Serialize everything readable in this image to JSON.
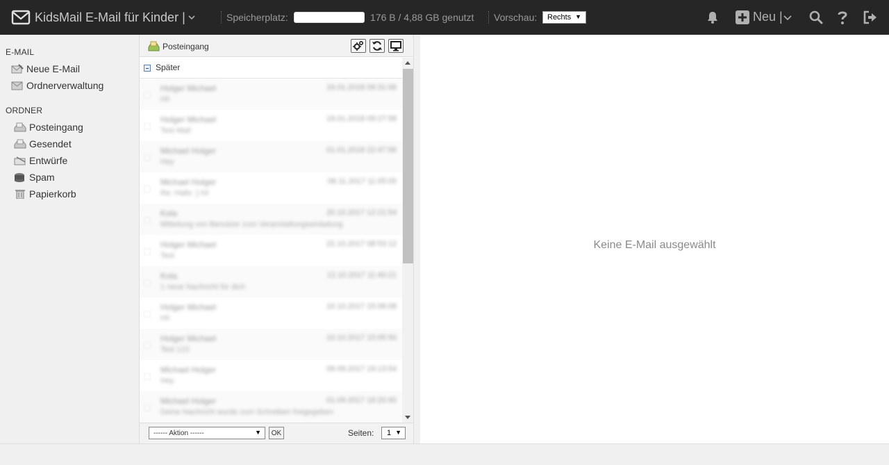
{
  "header": {
    "app_title": "KidsMail E-Mail für Kinder |",
    "storage_label": "Speicherplatz:",
    "storage_used_fraction": 0.0,
    "storage_text": "176 B / 4,88 GB genutzt",
    "preview_label": "Vorschau:",
    "preview_value": "Rechts",
    "new_label": "Neu |",
    "icons": [
      "mail-logo-icon",
      "chevron-down-icon",
      "bell-icon",
      "plus-square-icon",
      "search-icon",
      "help-icon",
      "logout-icon"
    ]
  },
  "sidebar": {
    "email_section": "E-MAIL",
    "email_items": [
      {
        "label": "Neue E-Mail",
        "icon": "compose-icon"
      },
      {
        "label": "Ordnerverwaltung",
        "icon": "folder-manage-icon"
      }
    ],
    "folder_section": "ORDNER",
    "folder_items": [
      {
        "label": "Posteingang",
        "icon": "inbox-icon"
      },
      {
        "label": "Gesendet",
        "icon": "sent-icon"
      },
      {
        "label": "Entwürfe",
        "icon": "drafts-icon"
      },
      {
        "label": "Spam",
        "icon": "spam-icon"
      },
      {
        "label": "Papierkorb",
        "icon": "trash-icon"
      }
    ]
  },
  "maillist": {
    "folder_title": "Posteingang",
    "toolbar_icons": [
      "settings-icon",
      "refresh-icon",
      "display-icon"
    ],
    "group_label": "Später",
    "rows": [
      {
        "sender": "Holger Michael",
        "date": "19.01.2018 09:31:06",
        "subject": "Hi!"
      },
      {
        "sender": "Holger Michael",
        "date": "19.01.2018 09:27:58",
        "subject": "Test Mail"
      },
      {
        "sender": "Michael Holger",
        "date": "01.01.2018 22:47:56",
        "subject": "Hey"
      },
      {
        "sender": "Michael Holger",
        "date": "08.11.2017 11:05:05",
        "subject": "Re: Hallo :) hi!"
      },
      {
        "sender": "Kola",
        "date": "20.10.2017 12:21:54",
        "subject": "Mitteilung von Benutzer zum Veranstaltungseinladung"
      },
      {
        "sender": "Holger Michael",
        "date": "22.10.2017 08:53:12",
        "subject": "Test"
      },
      {
        "sender": "Kola",
        "date": "12.10.2017 11:40:21",
        "subject": "1 neue Nachricht für dich"
      },
      {
        "sender": "Holger Michael",
        "date": "10.10.2017 15:06:08",
        "subject": "Hi!"
      },
      {
        "sender": "Holger Michael",
        "date": "10.10.2017 15:05:50",
        "subject": "Test 123"
      },
      {
        "sender": "Michael Holger",
        "date": "09.09.2017 19:13:54",
        "subject": "Hey"
      },
      {
        "sender": "Michael Holger",
        "date": "01.09.2017 16:20:40",
        "subject": "Deine Nachricht wurde zum Schreiben freigegeben"
      }
    ],
    "action_select": "------ Aktion ------",
    "ok_label": "OK",
    "pages_label": "Seiten:",
    "page_value": "1"
  },
  "preview": {
    "empty_text": "Keine E-Mail ausgewählt"
  }
}
